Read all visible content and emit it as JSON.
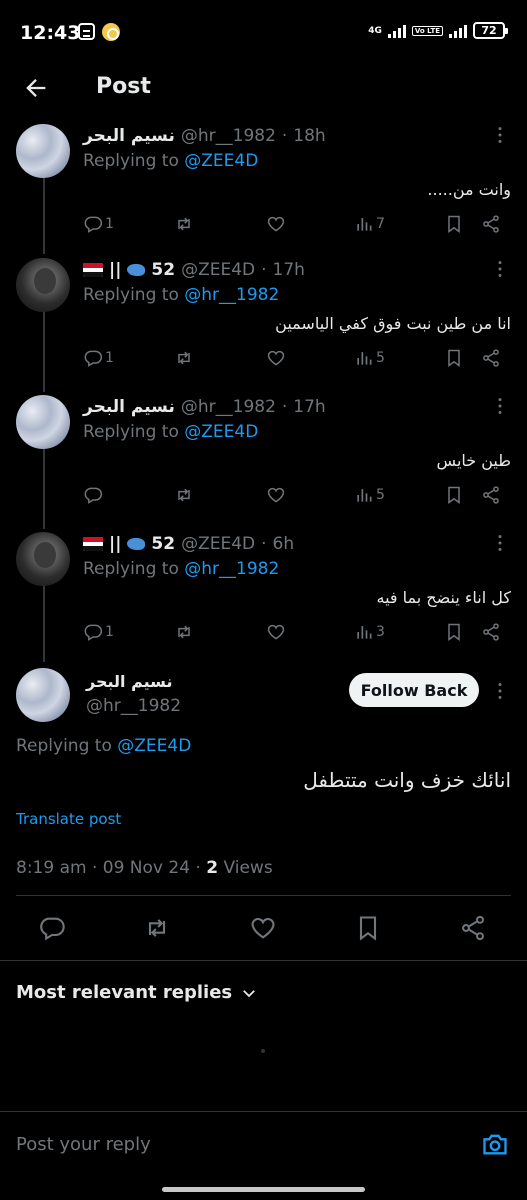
{
  "status_bar": {
    "time": "12:43",
    "network": "4G",
    "volte": "Vo LTE",
    "battery": "72"
  },
  "header": {
    "title": "Post"
  },
  "thread": [
    {
      "name": "نسيم البحر",
      "handle": "@hr__1982",
      "time": "18h",
      "replying_label": "Replying to",
      "replying_to": "@ZEE4D",
      "body": "وانت من.....",
      "replies": "1",
      "likes": "",
      "views": "7",
      "avatar": "sea"
    },
    {
      "name": "52",
      "handle": "@ZEE4D",
      "time": "17h",
      "replying_label": "Replying to",
      "replying_to": "@hr__1982",
      "body": "انا من طين نبت فوق كفي الياسمين",
      "replies": "1",
      "likes": "",
      "views": "5",
      "avatar": "man"
    },
    {
      "name": "نسيم البحر",
      "handle": "@hr__1982",
      "time": "17h",
      "replying_label": "Replying to",
      "replying_to": "@ZEE4D",
      "body": "طين خايس",
      "replies": "",
      "likes": "",
      "views": "5",
      "avatar": "sea"
    },
    {
      "name": "52",
      "handle": "@ZEE4D",
      "time": "6h",
      "replying_label": "Replying to",
      "replying_to": "@hr__1982",
      "body": "كل اناء ينضح بما فيه",
      "replies": "1",
      "likes": "",
      "views": "3",
      "avatar": "man"
    }
  ],
  "main_post": {
    "name": "نسيم البحر",
    "handle": "@hr__1982",
    "follow_label": "Follow Back",
    "replying_label": "Replying to",
    "replying_to": "@ZEE4D",
    "body": "انائك خزف وانت متتطفل",
    "translate_label": "Translate post",
    "timestamp": "8:19 am · 09 Nov 24 · ",
    "views_count": "2",
    "views_label": " Views"
  },
  "replies_section": {
    "sort_label": "Most relevant replies"
  },
  "reply_bar": {
    "placeholder": "Post your reply"
  },
  "colors": {
    "background": "#000000",
    "accent": "#1d9bf0",
    "muted": "#71767b",
    "text": "#e7e9ea"
  }
}
